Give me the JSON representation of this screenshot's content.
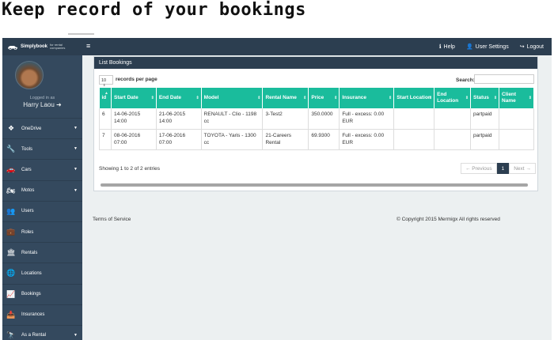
{
  "headline": "Keep record of your bookings",
  "topbar": {
    "brand_name": "Simplybook",
    "brand_sub": "for rental companies",
    "nav": [
      {
        "icon": "info-circle-icon",
        "glyph": "ℹ",
        "label": "Help"
      },
      {
        "icon": "user-icon",
        "glyph": "👤",
        "label": "User Settings"
      },
      {
        "icon": "sign-out-icon",
        "glyph": "↪",
        "label": "Logout"
      }
    ]
  },
  "sidebar": {
    "logged_in_as": "Logged in as",
    "user_name": "Harry Laou",
    "items": [
      {
        "label": "OneDrive",
        "icon": "dropbox-icon",
        "glyph": "❖",
        "caret": true
      },
      {
        "label": "Tools",
        "icon": "wrench-icon",
        "glyph": "🔧",
        "caret": true
      },
      {
        "label": "Cars",
        "icon": "car-icon",
        "glyph": "🚗",
        "caret": true
      },
      {
        "label": "Motos",
        "icon": "motorcycle-icon",
        "glyph": "🏍",
        "caret": true
      },
      {
        "label": "Users",
        "icon": "users-icon",
        "glyph": "👥",
        "caret": false
      },
      {
        "label": "Roles",
        "icon": "briefcase-icon",
        "glyph": "💼",
        "caret": false
      },
      {
        "label": "Rentals",
        "icon": "bank-icon",
        "glyph": "🏛",
        "caret": false
      },
      {
        "label": "Locations",
        "icon": "globe-icon",
        "glyph": "🌐",
        "caret": false
      },
      {
        "label": "Bookings",
        "icon": "line-chart-icon",
        "glyph": "📈",
        "caret": false
      },
      {
        "label": "Insurances",
        "icon": "inbox-icon",
        "glyph": "📥",
        "caret": false
      },
      {
        "label": "As a Rental",
        "icon": "binoculars-icon",
        "glyph": "🔭",
        "caret": true
      }
    ]
  },
  "panel": {
    "title": "List Bookings",
    "page_length": "10",
    "length_label": "records per page",
    "search_label": "Search:",
    "columns": [
      "id",
      "Start Date",
      "End Date",
      "Model",
      "Rental Name",
      "Price",
      "Insurance",
      "Start Location",
      "End Location",
      "Status",
      "Client Name"
    ],
    "rows": [
      [
        "6",
        "14-06-2015 14:00",
        "21-06-2015 14:00",
        "RENAULT - Clio - 1198 cc",
        "3-Test2",
        "350.0000",
        "Full - excess: 0.00 EUR",
        "",
        "",
        "partpaid",
        ""
      ],
      [
        "7",
        "08-06-2016 07:00",
        "17-06-2016 07:00",
        "TOYOTA - Yaris - 1300 cc",
        "21-Careers Rental",
        "69.9300",
        "Full - excess: 0.00 EUR",
        "",
        "",
        "partpaid",
        ""
      ]
    ],
    "info": "Showing 1 to 2 of 2 entries",
    "pager": {
      "prev": "← Previous",
      "page": "1",
      "next": "Next →"
    }
  },
  "footer": {
    "terms": "Terms of Service",
    "copyright": "© Copyright 2015 Mermigx All rights reserved"
  },
  "colors": {
    "sidebar": "#34495e",
    "topbar": "#2c3e50",
    "table_header": "#1abc9c",
    "content_bg": "#ecf0f1"
  }
}
